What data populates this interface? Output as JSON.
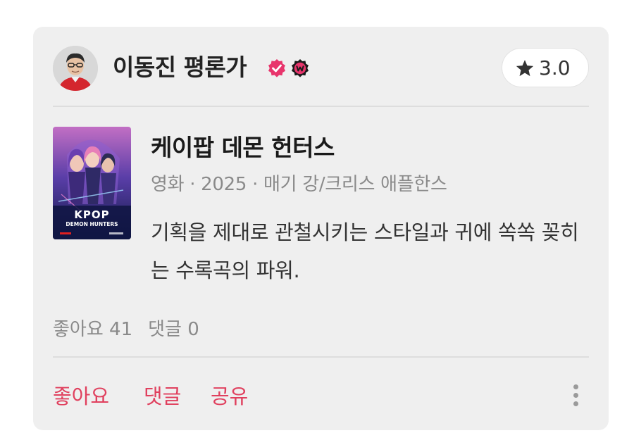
{
  "review": {
    "critic": {
      "name": "이동진 평론가",
      "avatar_icon": "person-avatar",
      "badges": [
        "verified-check-icon",
        "watcha-w-badge-icon"
      ]
    },
    "rating": {
      "star_icon": "star-icon",
      "value": "3.0"
    },
    "work": {
      "title": "케이팝 데몬 헌터스",
      "meta": "영화 · 2025 · 매기 강/크리스 애플한스",
      "poster": {
        "title": "KPOP",
        "subtitle": "DEMON HUNTERS"
      }
    },
    "text": "기획을 제대로 관철시키는 스타일과 귀에 쏙쏙 꽂히는 수록곡의 파워.",
    "stats": {
      "likes": "좋아요 41",
      "comments": "댓글 0"
    },
    "actions": {
      "like": "좋아요",
      "comment": "댓글",
      "share": "공유",
      "more_icon": "more-vertical-icon"
    }
  },
  "colors": {
    "accent": "#e0405e",
    "card_bg": "#efefef",
    "badge_pink": "#e8356c"
  }
}
